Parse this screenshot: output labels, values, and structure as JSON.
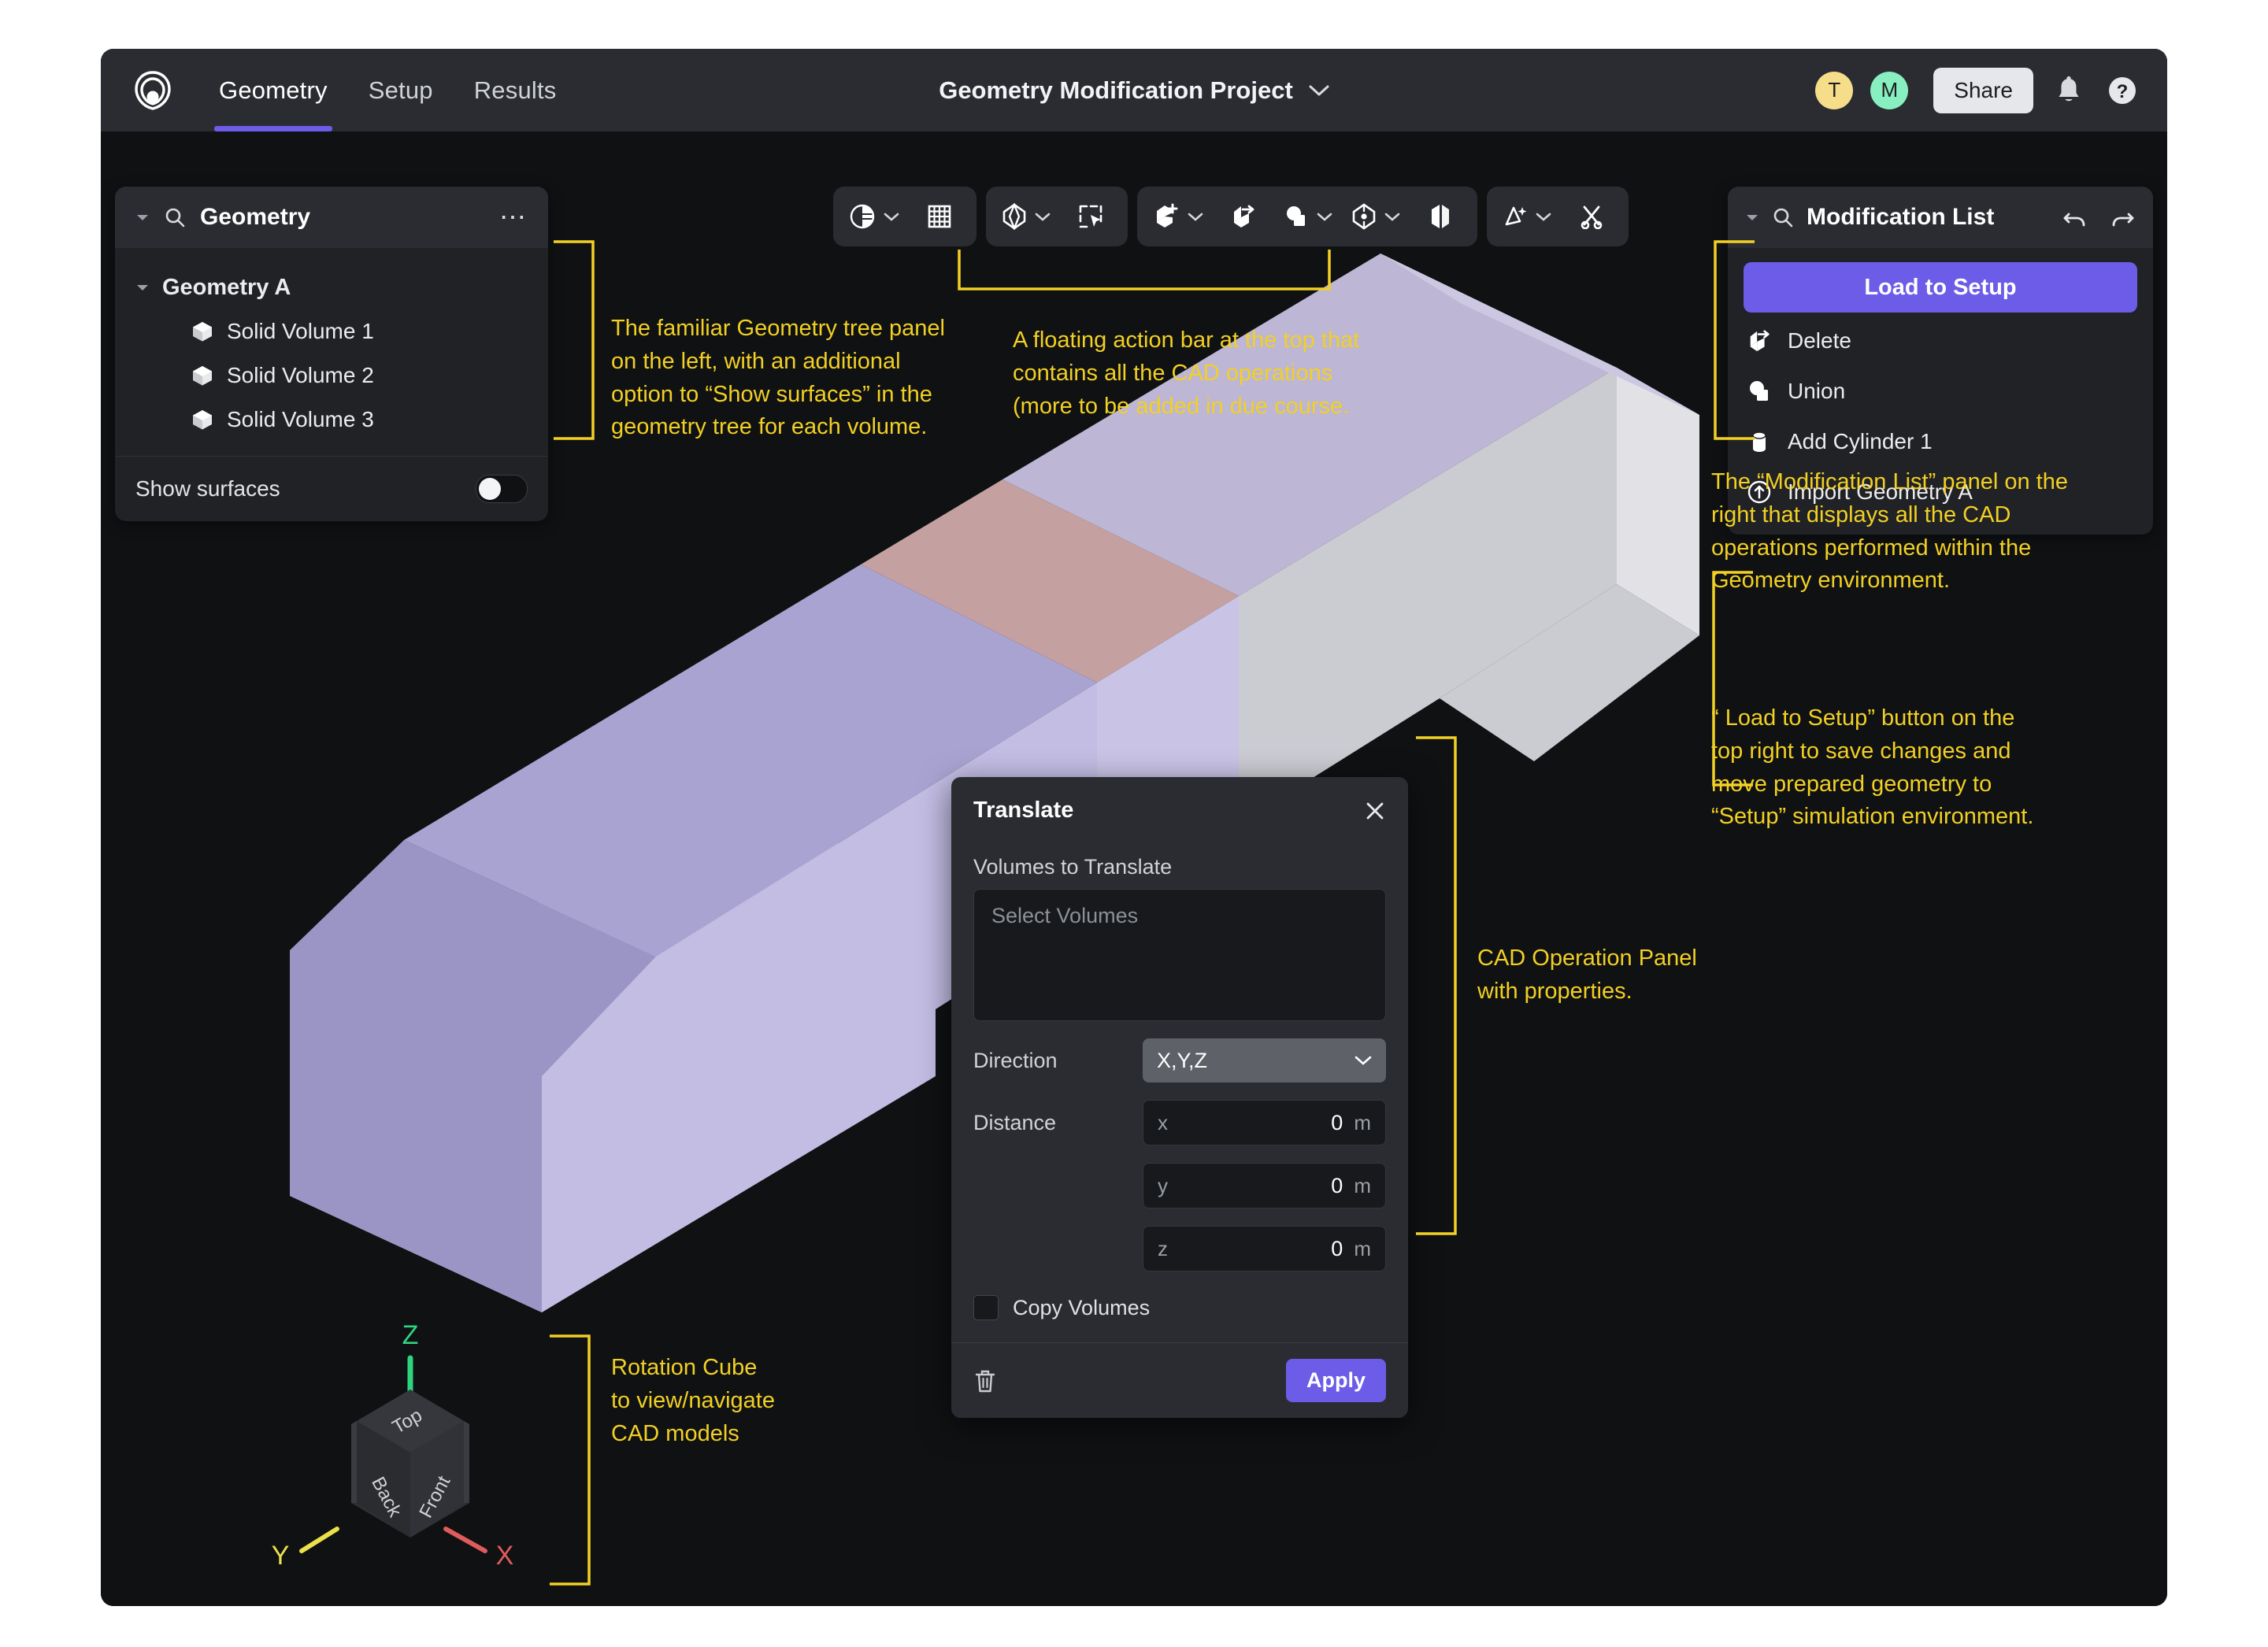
{
  "header": {
    "logo_icon": "luminary-spiral-logo",
    "tabs": [
      {
        "label": "Geometry",
        "active": true
      },
      {
        "label": "Setup",
        "active": false
      },
      {
        "label": "Results",
        "active": false
      }
    ],
    "project_title": "Geometry Modification Project",
    "project_chevron_icon": "chevron-down-icon",
    "avatars": [
      {
        "initial": "T",
        "color": "#f6dd8a"
      },
      {
        "initial": "M",
        "color": "#88efc0"
      }
    ],
    "share_label": "Share",
    "bell_icon": "notification-bell-icon",
    "help_icon": "help-question-icon",
    "accent": "#6c5ce7"
  },
  "tree_panel": {
    "search_icon": "search-icon",
    "caret_icon": "caret-down-icon",
    "title": "Geometry",
    "overflow_icon": "more-options-icon",
    "group": {
      "label": "Geometry A",
      "caret_icon": "caret-down-icon"
    },
    "items": [
      {
        "label": "Solid Volume 1",
        "icon": "cube-icon"
      },
      {
        "label": "Solid Volume 2",
        "icon": "cube-icon"
      },
      {
        "label": "Solid Volume 3",
        "icon": "cube-icon"
      }
    ],
    "footer": {
      "label": "Show surfaces",
      "toggle_state": "off"
    }
  },
  "toolbar": {
    "groups": [
      {
        "buttons": [
          {
            "icon": "shaded-sphere-display-icon",
            "has_caret": true
          },
          {
            "icon": "grid-mesh-icon",
            "has_caret": false
          }
        ]
      },
      {
        "buttons": [
          {
            "icon": "select-volume-icon",
            "has_caret": true
          },
          {
            "icon": "box-select-icon",
            "has_caret": false
          }
        ]
      },
      {
        "buttons": [
          {
            "icon": "add-primitive-icon",
            "has_caret": true
          },
          {
            "icon": "delete-volume-icon",
            "has_caret": false
          },
          {
            "icon": "boolean-union-icon",
            "has_caret": true
          },
          {
            "icon": "transform-icon",
            "has_caret": true
          },
          {
            "icon": "mirror-icon",
            "has_caret": false
          }
        ]
      },
      {
        "buttons": [
          {
            "icon": "magic-wand-icon",
            "has_caret": true
          },
          {
            "icon": "scissors-cut-icon",
            "has_caret": false
          }
        ]
      }
    ]
  },
  "mod_panel": {
    "caret_icon": "caret-down-icon",
    "search_icon": "search-icon",
    "title": "Modification List",
    "undo_icon": "undo-icon",
    "redo_icon": "redo-icon",
    "load_button": "Load to Setup",
    "items": [
      {
        "label": "Delete",
        "icon": "delete-volume-icon"
      },
      {
        "label": "Union",
        "icon": "boolean-union-icon"
      },
      {
        "label": "Add Cylinder 1",
        "icon": "cylinder-icon"
      },
      {
        "label": "Import Geometry A",
        "icon": "import-arrow-icon"
      }
    ]
  },
  "dialog": {
    "title": "Translate",
    "close_icon": "close-icon",
    "volumes_label": "Volumes to Translate",
    "volumes_placeholder": "Select Volumes",
    "direction_label": "Direction",
    "direction_value": "X,Y,Z",
    "direction_caret_icon": "chevron-down-icon",
    "distance_label": "Distance",
    "distance_fields": [
      {
        "axis": "x",
        "value": "0",
        "unit": "m"
      },
      {
        "axis": "y",
        "value": "0",
        "unit": "m"
      },
      {
        "axis": "z",
        "value": "0",
        "unit": "m"
      }
    ],
    "copy_label": "Copy Volumes",
    "copy_checked": false,
    "trash_icon": "trash-icon",
    "apply_label": "Apply"
  },
  "rotation_cube": {
    "top_face": "Top",
    "back_face": "Back",
    "front_face": "Front",
    "axis_z": "Z",
    "axis_y": "Y",
    "axis_x": "X",
    "axis_z_color": "#2fd47e",
    "axis_y_color": "#ece14a",
    "axis_x_color": "#e05b5b"
  },
  "annotations": {
    "tree": "The familiar Geometry tree panel\non the left, with an additional\noption to “Show surfaces” in the\ngeometry tree for each volume.",
    "toolbar": "A floating action bar at the top that\ncontains all the CAD operations\n(more to be added in due course.",
    "mod_list": "The “Modification List” panel on the\nright that displays all the CAD\noperations performed within the\nGeometry environment.",
    "load_setup": "“ Load to Setup” button on the\ntop right to save changes and\nmove prepared geometry to\n“Setup” simulation environment.",
    "cad_panel": "CAD Operation Panel\nwith properties.",
    "rotation_cube": "Rotation Cube\nto view/navigate\nCAD models",
    "color": "#f2d024"
  },
  "geometry_3d": {
    "faces": [
      {
        "name": "top-lavender-left",
        "color": "#a8a3d1"
      },
      {
        "name": "top-salmon-mid",
        "color": "#c4a0a0"
      },
      {
        "name": "top-lavender-right",
        "color": "#bdb6d4"
      },
      {
        "name": "front-light-lavender",
        "color": "#c3bde4"
      },
      {
        "name": "front-grey-right",
        "color": "#cbcbd2"
      },
      {
        "name": "side-dark-lavender",
        "color": "#8f8bb8"
      }
    ]
  }
}
